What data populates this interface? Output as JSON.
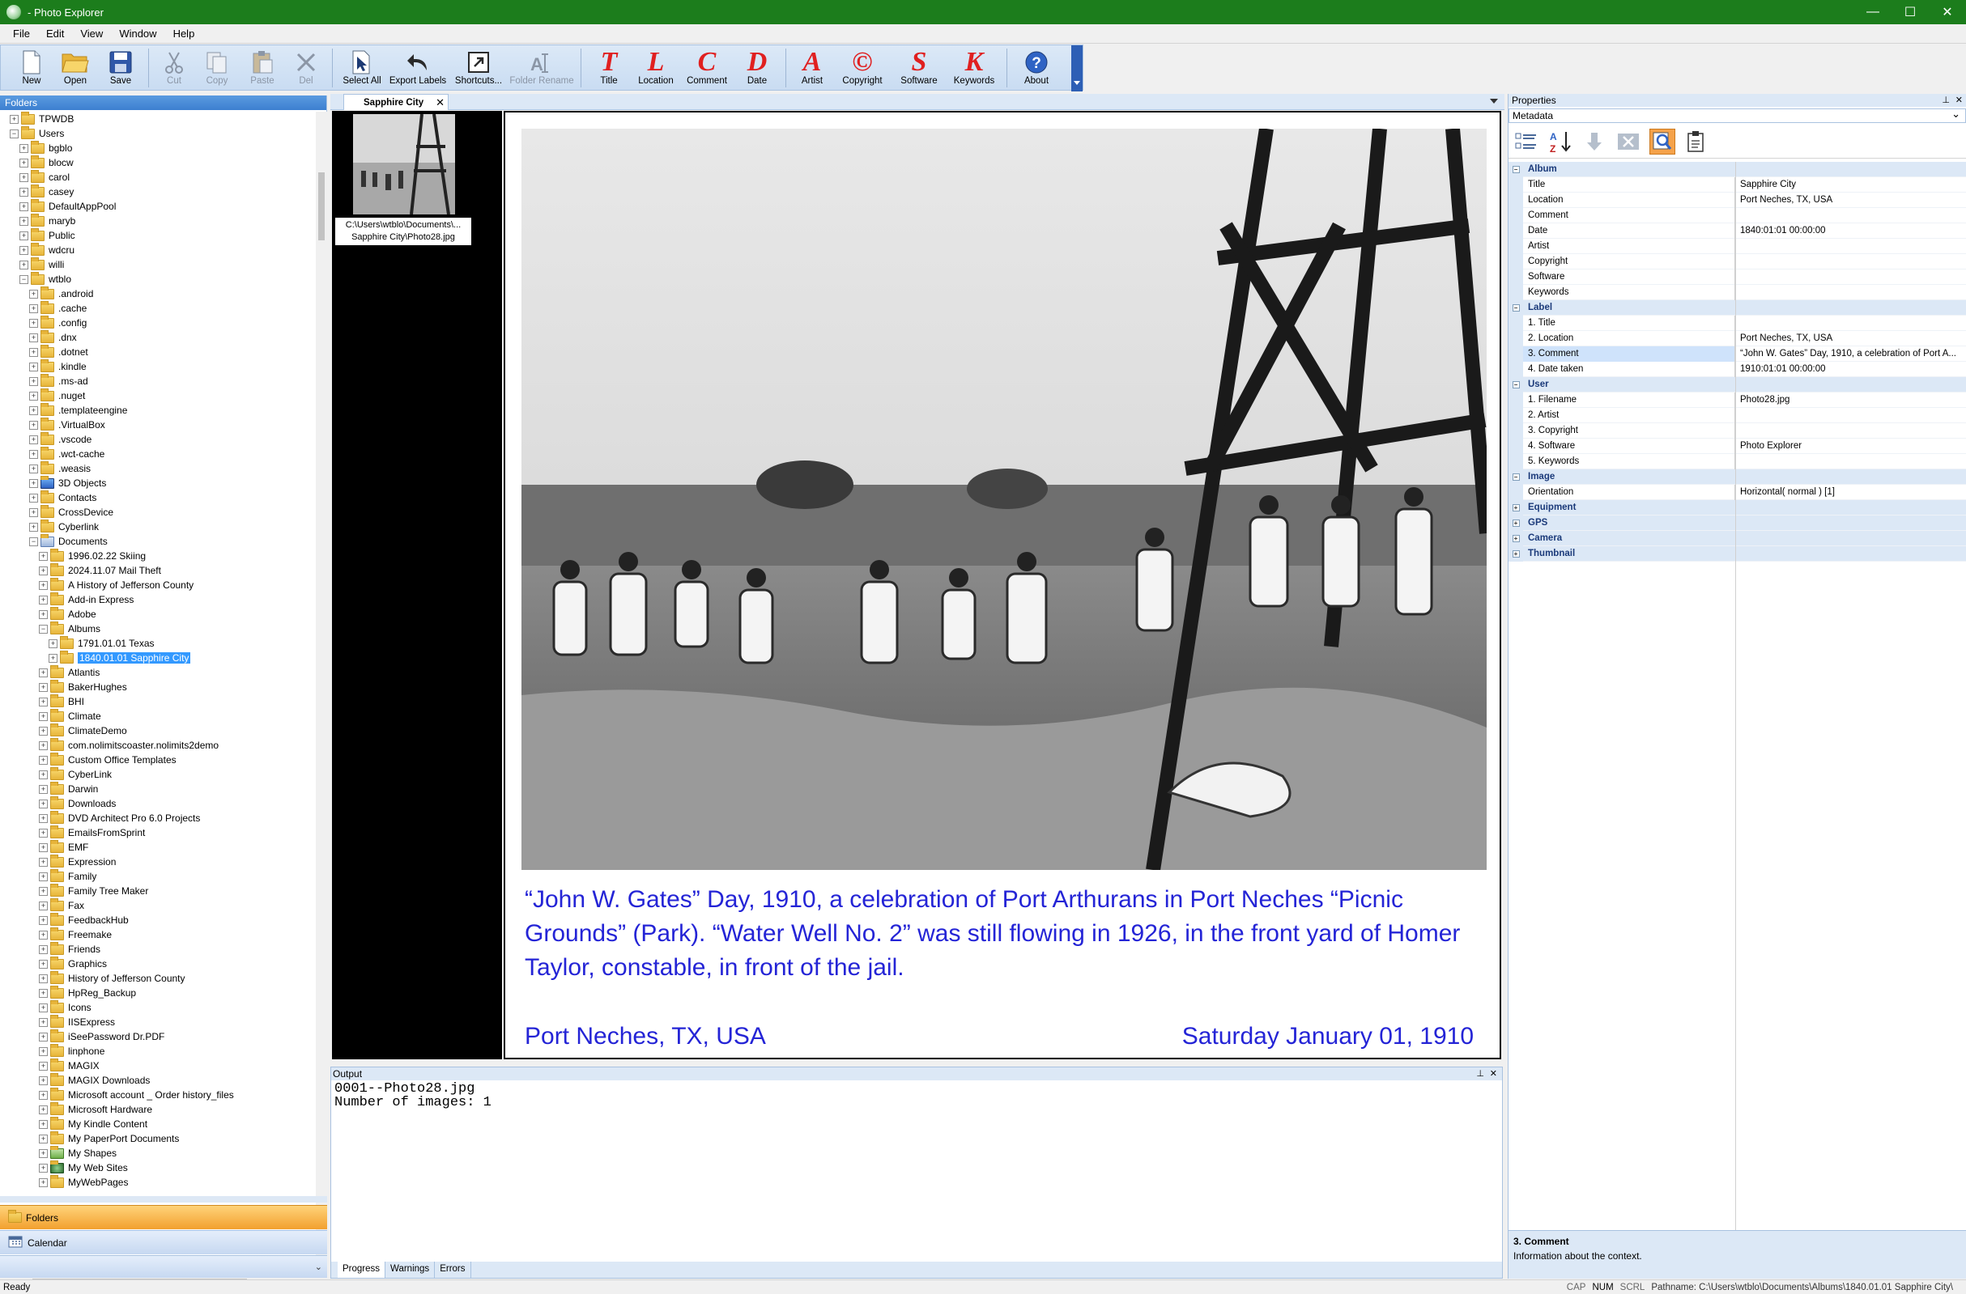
{
  "window": {
    "title": "- Photo Explorer",
    "minimize": "—",
    "maximize": "☐",
    "close": "✕"
  },
  "menu": [
    "File",
    "Edit",
    "View",
    "Window",
    "Help"
  ],
  "toolbar": {
    "new": "New",
    "open": "Open",
    "save": "Save",
    "cut": "Cut",
    "copy": "Copy",
    "paste": "Paste",
    "del": "Del",
    "select_all": "Select All",
    "export_labels": "Export Labels",
    "shortcuts": "Shortcuts...",
    "folder_rename": "Folder Rename",
    "title": "Title",
    "location": "Location",
    "comment": "Comment",
    "date": "Date",
    "artist": "Artist",
    "copyright": "Copyright",
    "software": "Software",
    "keywords": "Keywords",
    "about": "About",
    "letters": {
      "title": "T",
      "location": "L",
      "comment": "C",
      "date": "D",
      "artist": "A",
      "copyright": "©",
      "software": "S",
      "keywords": "K"
    }
  },
  "folders_panel": {
    "header": "Folders",
    "tree": [
      {
        "label": "TPWDB",
        "level": 1,
        "exp": "+"
      },
      {
        "label": "Users",
        "level": 1,
        "exp": "−"
      },
      {
        "label": "bgblo",
        "level": 2,
        "exp": "+"
      },
      {
        "label": "blocw",
        "level": 2,
        "exp": "+"
      },
      {
        "label": "carol",
        "level": 2,
        "exp": "+"
      },
      {
        "label": "casey",
        "level": 2,
        "exp": "+"
      },
      {
        "label": "DefaultAppPool",
        "level": 2,
        "exp": "+"
      },
      {
        "label": "maryb",
        "level": 2,
        "exp": "+"
      },
      {
        "label": "Public",
        "level": 2,
        "exp": "+"
      },
      {
        "label": "wdcru",
        "level": 2,
        "exp": "+"
      },
      {
        "label": "willi",
        "level": 2,
        "exp": "+"
      },
      {
        "label": "wtblo",
        "level": 2,
        "exp": "−"
      },
      {
        "label": ".android",
        "level": 3,
        "exp": "+"
      },
      {
        "label": ".cache",
        "level": 3,
        "exp": "+"
      },
      {
        "label": ".config",
        "level": 3,
        "exp": "+"
      },
      {
        "label": ".dnx",
        "level": 3,
        "exp": "+"
      },
      {
        "label": ".dotnet",
        "level": 3,
        "exp": "+"
      },
      {
        "label": ".kindle",
        "level": 3,
        "exp": "+"
      },
      {
        "label": ".ms-ad",
        "level": 3,
        "exp": "+"
      },
      {
        "label": ".nuget",
        "level": 3,
        "exp": "+"
      },
      {
        "label": ".templateengine",
        "level": 3,
        "exp": "+"
      },
      {
        "label": ".VirtualBox",
        "level": 3,
        "exp": "+"
      },
      {
        "label": ".vscode",
        "level": 3,
        "exp": "+"
      },
      {
        "label": ".wct-cache",
        "level": 3,
        "exp": "+"
      },
      {
        "label": ".weasis",
        "level": 3,
        "exp": "+"
      },
      {
        "label": "3D Objects",
        "level": 3,
        "exp": "+",
        "icon": "cube"
      },
      {
        "label": "Contacts",
        "level": 3,
        "exp": "+"
      },
      {
        "label": "CrossDevice",
        "level": 3,
        "exp": "+"
      },
      {
        "label": "Cyberlink",
        "level": 3,
        "exp": "+"
      },
      {
        "label": "Documents",
        "level": 3,
        "exp": "−",
        "icon": "doc"
      },
      {
        "label": "1996.02.22 Skiing",
        "level": 4,
        "exp": "+"
      },
      {
        "label": "2024.11.07 Mail Theft",
        "level": 4,
        "exp": "+"
      },
      {
        "label": "A History of Jefferson County",
        "level": 4,
        "exp": "+"
      },
      {
        "label": "Add-in Express",
        "level": 4,
        "exp": "+"
      },
      {
        "label": "Adobe",
        "level": 4,
        "exp": "+"
      },
      {
        "label": "Albums",
        "level": 4,
        "exp": "−"
      },
      {
        "label": "1791.01.01 Texas",
        "level": 5,
        "exp": "+"
      },
      {
        "label": "1840.01.01 Sapphire City",
        "level": 5,
        "exp": "+",
        "selected": true
      },
      {
        "label": "Atlantis",
        "level": 4,
        "exp": "+"
      },
      {
        "label": "BakerHughes",
        "level": 4,
        "exp": "+"
      },
      {
        "label": "BHI",
        "level": 4,
        "exp": "+"
      },
      {
        "label": "Climate",
        "level": 4,
        "exp": "+"
      },
      {
        "label": "ClimateDemo",
        "level": 4,
        "exp": "+"
      },
      {
        "label": "com.nolimitscoaster.nolimits2demo",
        "level": 4,
        "exp": "+"
      },
      {
        "label": "Custom Office Templates",
        "level": 4,
        "exp": "+"
      },
      {
        "label": "CyberLink",
        "level": 4,
        "exp": "+"
      },
      {
        "label": "Darwin",
        "level": 4,
        "exp": "+"
      },
      {
        "label": "Downloads",
        "level": 4,
        "exp": "+"
      },
      {
        "label": "DVD Architect Pro 6.0 Projects",
        "level": 4,
        "exp": "+"
      },
      {
        "label": "EmailsFromSprint",
        "level": 4,
        "exp": "+"
      },
      {
        "label": "EMF",
        "level": 4,
        "exp": "+"
      },
      {
        "label": "Expression",
        "level": 4,
        "exp": "+"
      },
      {
        "label": "Family",
        "level": 4,
        "exp": "+"
      },
      {
        "label": "Family Tree Maker",
        "level": 4,
        "exp": "+"
      },
      {
        "label": "Fax",
        "level": 4,
        "exp": "+"
      },
      {
        "label": "FeedbackHub",
        "level": 4,
        "exp": "+"
      },
      {
        "label": "Freemake",
        "level": 4,
        "exp": "+"
      },
      {
        "label": "Friends",
        "level": 4,
        "exp": "+"
      },
      {
        "label": "Graphics",
        "level": 4,
        "exp": "+"
      },
      {
        "label": "History of Jefferson County",
        "level": 4,
        "exp": "+"
      },
      {
        "label": "HpReg_Backup",
        "level": 4,
        "exp": "+"
      },
      {
        "label": "Icons",
        "level": 4,
        "exp": "+"
      },
      {
        "label": "IISExpress",
        "level": 4,
        "exp": "+"
      },
      {
        "label": "iSeePassword Dr.PDF",
        "level": 4,
        "exp": "+"
      },
      {
        "label": "linphone",
        "level": 4,
        "exp": "+"
      },
      {
        "label": "MAGIX",
        "level": 4,
        "exp": "+"
      },
      {
        "label": "MAGIX Downloads",
        "level": 4,
        "exp": "+"
      },
      {
        "label": "Microsoft account _ Order history_files",
        "level": 4,
        "exp": "+"
      },
      {
        "label": "Microsoft Hardware",
        "level": 4,
        "exp": "+"
      },
      {
        "label": "My Kindle Content",
        "level": 4,
        "exp": "+"
      },
      {
        "label": "My PaperPort Documents",
        "level": 4,
        "exp": "+"
      },
      {
        "label": "My Shapes",
        "level": 4,
        "exp": "+",
        "icon": "shapes"
      },
      {
        "label": "My Web Sites",
        "level": 4,
        "exp": "+",
        "icon": "web"
      },
      {
        "label": "MyWebPages",
        "level": 4,
        "exp": "+"
      }
    ]
  },
  "nav": {
    "folders": "Folders",
    "calendar": "Calendar"
  },
  "tab": {
    "label": "Sapphire City"
  },
  "thumbnail": {
    "caption_line1": "C:\\Users\\wtblo\\Documents\\...",
    "caption_line2": "Sapphire City\\Photo28.jpg"
  },
  "viewer": {
    "caption": "“John W. Gates” Day, 1910, a celebration of Port Arthurans in Port Neches “Picnic Grounds” (Park). “Water Well No. 2” was still flowing in 1926, in the front yard of Homer Taylor, constable, in front of the jail.",
    "location": "Port Neches, TX, USA",
    "date": "Saturday January 01, 1910",
    "text_color": "#2424d6"
  },
  "output": {
    "header": "Output",
    "lines": "0001--Photo28.jpg\nNumber of images: 1",
    "tabs": [
      "Progress",
      "Warnings",
      "Errors"
    ]
  },
  "properties": {
    "header": "Properties",
    "combo": "Metadata",
    "rows": [
      {
        "cat": true,
        "name": "Album",
        "exp": "−"
      },
      {
        "name": "Title",
        "value": "Sapphire City"
      },
      {
        "name": "Location",
        "value": "Port Neches, TX, USA"
      },
      {
        "name": "Comment",
        "value": ""
      },
      {
        "name": "Date",
        "value": "1840:01:01 00:00:00"
      },
      {
        "name": "Artist",
        "value": ""
      },
      {
        "name": "Copyright",
        "value": ""
      },
      {
        "name": "Software",
        "value": ""
      },
      {
        "name": "Keywords",
        "value": ""
      },
      {
        "cat": true,
        "name": "Label",
        "exp": "−"
      },
      {
        "name": "1. Title",
        "value": ""
      },
      {
        "name": "2. Location",
        "value": "Port Neches, TX, USA"
      },
      {
        "name": "3. Comment",
        "value": "“John W. Gates” Day, 1910, a celebration of Port A...",
        "selected": true
      },
      {
        "name": "4. Date taken",
        "value": "1910:01:01 00:00:00"
      },
      {
        "cat": true,
        "name": "User",
        "exp": "−"
      },
      {
        "name": "1. Filename",
        "value": "Photo28.jpg"
      },
      {
        "name": "2. Artist",
        "value": ""
      },
      {
        "name": "3. Copyright",
        "value": ""
      },
      {
        "name": "4. Software",
        "value": "Photo Explorer"
      },
      {
        "name": "5. Keywords",
        "value": ""
      },
      {
        "cat": true,
        "name": "Image",
        "exp": "−"
      },
      {
        "name": "Orientation",
        "value": "Horizontal( normal ) [1]"
      },
      {
        "cat": true,
        "name": "Equipment",
        "exp": "+"
      },
      {
        "cat": true,
        "name": "GPS",
        "exp": "+"
      },
      {
        "cat": true,
        "name": "Camera",
        "exp": "+"
      },
      {
        "cat": true,
        "name": "Thumbnail",
        "exp": "+"
      }
    ],
    "description_title": "3. Comment",
    "description_text": "Information about the context."
  },
  "status": {
    "ready": "Ready",
    "cap": "CAP",
    "num": "NUM",
    "scrl": "SCRL",
    "pathname": "Pathname: C:\\Users\\wtblo\\Documents\\Albums\\1840.01.01 Sapphire City\\"
  }
}
